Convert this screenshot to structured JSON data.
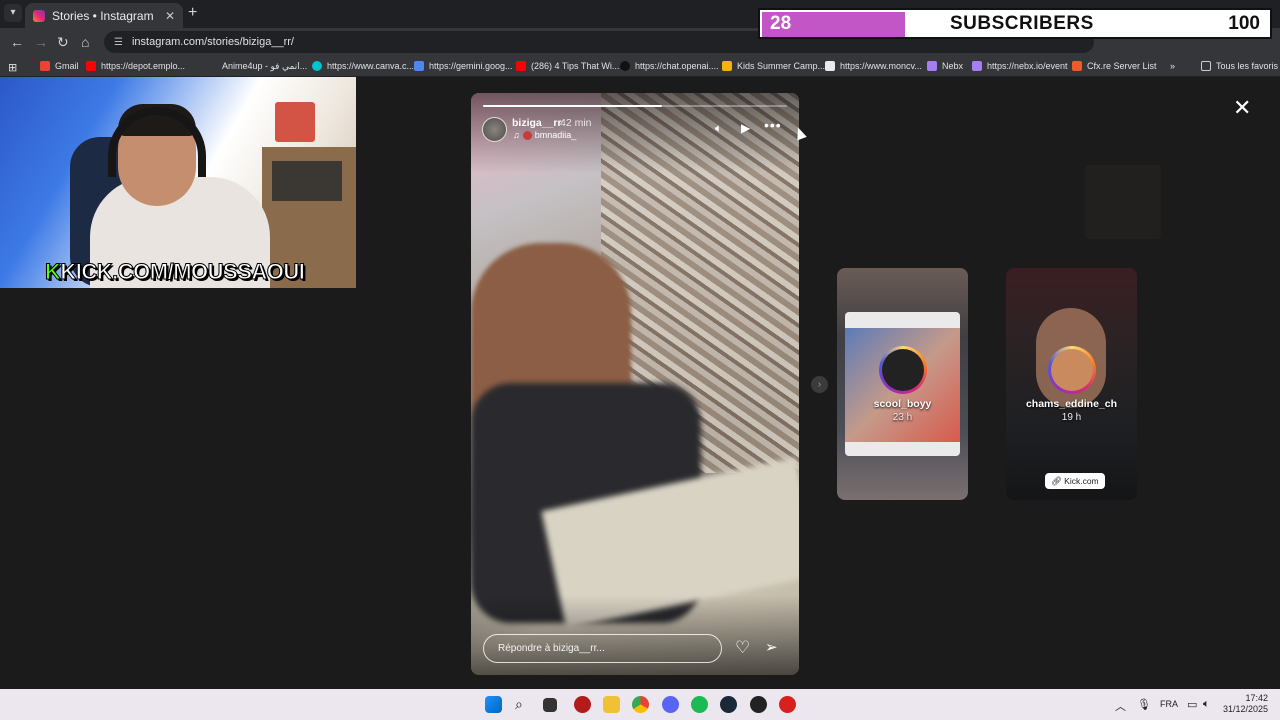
{
  "browser": {
    "tab_title": "Stories • Instagram",
    "url": "instagram.com/stories/biziga__rr/",
    "bookmarks": [
      {
        "label": "Gmail",
        "color": "#ea4335"
      },
      {
        "label": "https://depot.emplo...",
        "color": "#ff0000"
      },
      {
        "label": "Anime4up - انمي فو...",
        "color": "#35363a"
      },
      {
        "label": "https://www.canva.c...",
        "color": "#00c4cc"
      },
      {
        "label": "https://gemini.goog...",
        "color": "#4e86f2"
      },
      {
        "label": "(286) 4 Tips That Wi...",
        "color": "#ff0000"
      },
      {
        "label": "https://chat.openai....",
        "color": "#111111"
      },
      {
        "label": "Kids Summer Camp...",
        "color": "#f4b400"
      },
      {
        "label": "https://www.moncv...",
        "color": "#e8eaed"
      },
      {
        "label": "Nebx",
        "color": "#a77ef2"
      },
      {
        "label": "https://nebx.io/event",
        "color": "#a77ef2"
      },
      {
        "label": "Cfx.re Server List",
        "color": "#f05a28"
      }
    ],
    "other_bookmarks": "Tous les favoris"
  },
  "overlay": {
    "subscriber_count": "28",
    "subscriber_label": "SUBSCRIBERS",
    "subscriber_goal": "100",
    "kick_handle": "KICK.COM/MOUSSAOUI",
    "kick_letter": "K"
  },
  "story": {
    "username": "biziga__rr",
    "time": "42 min",
    "music": "bmnadiia_",
    "progress": 0.59,
    "reply_placeholder": "Répondre à biziga__rr..."
  },
  "next_stories": [
    {
      "name": "scool_boyy",
      "time": "23 h"
    },
    {
      "name": "chams_eddine_ch",
      "time": "19 h",
      "link": "Kick.com"
    }
  ],
  "taskbar": {
    "language": "FRA",
    "time": "17:42",
    "date": "31/12/2025"
  }
}
